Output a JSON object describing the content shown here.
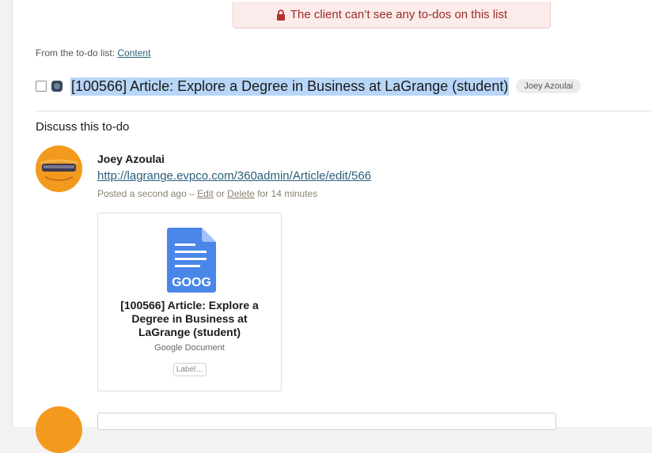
{
  "banner": {
    "text": "The client can’t see any to-dos on this list",
    "icon": "lock-icon",
    "color": "#9b2c24"
  },
  "breadcrumb": {
    "prefix": "From the to-do list:",
    "list_name": "Content"
  },
  "todo": {
    "checked": false,
    "title": "[100566] Article: Explore a Degree in Business at LaGrange (student)",
    "assignee": "Joey Azoulai",
    "highlight_color": "#b8d6f7"
  },
  "discussion": {
    "heading": "Discuss this to-do",
    "comment": {
      "author": "Joey Azoulai",
      "link": "http://lagrange.evpco.com/360admin/Article/edit/566",
      "posted": "Posted a second ago –",
      "edit_label": "Edit",
      "or_text": "or",
      "delete_label": "Delete",
      "for_text": "for 14 minutes",
      "attachment": {
        "icon_label": "GOOG",
        "title": "[100566] Article: Explore a Degree in Business at LaGrange (student)",
        "type": "Google Document",
        "label_button": "Label…",
        "icon_color": "#4a86e8"
      }
    }
  },
  "colors": {
    "avatar_orange": "#f39a1e",
    "link": "#2b5f7a"
  }
}
